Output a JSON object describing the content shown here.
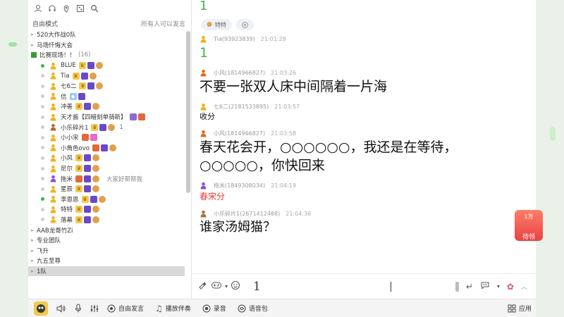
{
  "sidebar": {
    "mode_label": "自由模式",
    "permission_label": "所有人可以发言",
    "tree": [
      {
        "type": "channel",
        "name": "520大作战0队",
        "count": ""
      },
      {
        "type": "channel",
        "name": "马场忏悔大会",
        "count": ""
      },
      {
        "type": "room",
        "name": "比赛现场！！",
        "count": "(16)"
      },
      {
        "type": "member",
        "online": true,
        "role": "yellow",
        "name": "BLUE",
        "badges": [
          "crown",
          "vip",
          "coin"
        ],
        "num": "",
        "note": ""
      },
      {
        "type": "member",
        "online": false,
        "role": "yellow",
        "name": "Tia",
        "badges": [
          "crown",
          "vip",
          "coin"
        ],
        "num": "",
        "note": ""
      },
      {
        "type": "member",
        "online": false,
        "role": "yellow",
        "name": "七6二",
        "badges": [
          "crown",
          "vip",
          "coin"
        ],
        "num": "",
        "note": ""
      },
      {
        "type": "member",
        "online": false,
        "role": "yellow",
        "name": "信",
        "badges": [
          "gem",
          "vip"
        ],
        "num": "",
        "note": ""
      },
      {
        "type": "member",
        "online": false,
        "role": "yellow",
        "name": "冲善",
        "badges": [
          "crown",
          "vip",
          "coin"
        ],
        "num": "",
        "note": ""
      },
      {
        "type": "member",
        "online": false,
        "role": "yellow",
        "name": "天才酱【四暗刻单骑新】",
        "badges": [
          "purple",
          "fire"
        ],
        "num": "",
        "note": ""
      },
      {
        "type": "member",
        "online": false,
        "role": "brown",
        "name": "小乐碎片1",
        "badges": [
          "crown",
          "vip",
          "coin"
        ],
        "num": "1",
        "note": ""
      },
      {
        "type": "member",
        "online": false,
        "role": "yellow",
        "name": "小小宋",
        "badges": [
          "fire",
          "pink"
        ],
        "num": "",
        "note": ""
      },
      {
        "type": "member",
        "online": false,
        "role": "yellow",
        "name": "小角色ovo",
        "badges": [
          "fire",
          "vip",
          "coin"
        ],
        "num": "",
        "note": ""
      },
      {
        "type": "member",
        "online": false,
        "role": "yellow",
        "name": "小风",
        "badges": [
          "crown",
          "vip",
          "coin"
        ],
        "num": "",
        "note": ""
      },
      {
        "type": "member",
        "online": false,
        "role": "yellow",
        "name": "尼尔",
        "badges": [
          "crown",
          "vip",
          "coin"
        ],
        "num": "",
        "note": ""
      },
      {
        "type": "member",
        "online": false,
        "role": "purple",
        "name": "拖米",
        "badges": [
          "fire",
          "vip",
          "coin"
        ],
        "num": "",
        "note": "大家好帮帮我"
      },
      {
        "type": "member",
        "online": false,
        "role": "yellow",
        "name": "星辰",
        "badges": [
          "crown",
          "vip",
          "coin"
        ],
        "num": "",
        "note": ""
      },
      {
        "type": "member",
        "online": true,
        "role": "yellow",
        "name": "李恩恩",
        "badges": [
          "crown",
          "vip",
          "coin"
        ],
        "num": "",
        "note": ""
      },
      {
        "type": "member",
        "online": false,
        "role": "yellow",
        "name": "特特",
        "badges": [
          "crown",
          "vip",
          "coin"
        ],
        "num": "",
        "note": ""
      },
      {
        "type": "member",
        "online": false,
        "role": "yellow",
        "name": "落幕",
        "badges": [
          "crown",
          "vip",
          "coin"
        ],
        "num": "",
        "note": ""
      },
      {
        "type": "channel",
        "name": "AAB龙哥竹Zi",
        "count": ""
      },
      {
        "type": "channel",
        "name": "专业团队",
        "count": ""
      },
      {
        "type": "channel",
        "name": "飞升",
        "count": ""
      },
      {
        "type": "channel",
        "name": "九五至尊",
        "count": ""
      },
      {
        "type": "channel",
        "name": "1队",
        "count": "",
        "selected": true
      }
    ]
  },
  "chat": {
    "top_partial": "1",
    "tag_label": "特特",
    "messages": [
      {
        "role": "yellow",
        "sender": "Tia(93923839)",
        "time": "21:01:29",
        "text": "1",
        "style": "green"
      },
      {
        "role": "orange",
        "sender": "小风(1814966827)",
        "time": "21:03:26",
        "text": "不要一张双人床中间隔着一片海",
        "style": "big"
      },
      {
        "role": "yellow",
        "sender": "七6二(2181533895)",
        "time": "21:03:57",
        "text": "收分",
        "style": "small"
      },
      {
        "role": "orange",
        "sender": "小风(1814966827)",
        "time": "21:03:58",
        "text": "春天花会开，○○○○○○，我还是在等待，○○○○○，你快回来",
        "style": "big"
      },
      {
        "role": "purple",
        "sender": "拖米(1849308034)",
        "time": "21:04:19",
        "text": "春宋分",
        "style": "red"
      },
      {
        "role": "brown",
        "sender": "小乐碎片1(2671412488)",
        "time": "21:04:36",
        "text": "谁家汤姆猫？",
        "style": "serif"
      }
    ]
  },
  "input": {
    "value": "1"
  },
  "bottom_bar": {
    "free_speak": "自由发言",
    "play_music": "播放伴奏",
    "record": "录音",
    "voice_pack": "语音包",
    "apps": "应用"
  },
  "promo": {
    "line1": "1万",
    "line2": "待领"
  },
  "colors": {
    "online": "#38b24a",
    "green_text": "#43b543",
    "red_text": "#e23a3a"
  }
}
